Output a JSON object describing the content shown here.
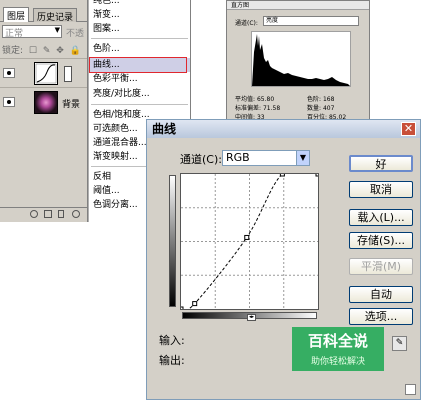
{
  "layers_panel": {
    "tabs": [
      {
        "label": "图层"
      },
      {
        "label": "历史记录"
      }
    ],
    "blend_mode": "正常",
    "opacity_label": "不透",
    "lock_label": "锁定:",
    "lock_icons": [
      "☐",
      "✎",
      "✥",
      "🔒"
    ],
    "layers": [
      {
        "name": ""
      },
      {
        "name": "背景"
      }
    ]
  },
  "image_menu": {
    "items": [
      {
        "label": "纯色..."
      },
      {
        "label": "渐变..."
      },
      {
        "label": "图案..."
      },
      {
        "label": "色阶..."
      },
      {
        "label": "曲线..."
      },
      {
        "label": "色彩平衡..."
      },
      {
        "label": "亮度/对比度..."
      },
      {
        "label": "色相/饱和度..."
      },
      {
        "label": "可选颜色..."
      },
      {
        "label": "通道混合器..."
      },
      {
        "label": "渐变映射..."
      },
      {
        "label": "反相"
      },
      {
        "label": "阈值..."
      },
      {
        "label": "色调分离..."
      }
    ],
    "selected_label": "曲线..."
  },
  "histogram_panel": {
    "title": "直方图",
    "channel_label": "通道(C):",
    "channel_value": "亮度",
    "stats": [
      {
        "label": "平均值:",
        "value": "65.80"
      },
      {
        "label": "色阶:",
        "value": "168"
      },
      {
        "label": "标准偏差:",
        "value": "71.58"
      },
      {
        "label": "数量:",
        "value": "407"
      },
      {
        "label": "中间值:",
        "value": "33"
      },
      {
        "label": "百分位:",
        "value": "85.02"
      }
    ]
  },
  "curves_dialog": {
    "title": "曲线",
    "channel_label": "通道(C):",
    "channel_value": "RGB",
    "input_label": "输入:",
    "output_label": "输出:",
    "buttons": {
      "ok": "好",
      "cancel": "取消",
      "load": "载入(L)...",
      "save": "存储(S)...",
      "smooth": "平滑(M)",
      "auto": "自动",
      "options": "选项..."
    },
    "curve_points": [
      {
        "input": 0,
        "output": 0
      },
      {
        "input": 10,
        "output": 4
      },
      {
        "input": 48,
        "output": 53
      },
      {
        "input": 74,
        "output": 100
      },
      {
        "input": 100,
        "output": 100
      }
    ]
  },
  "watermark": {
    "title": "百科全说",
    "subtitle": "助你轻松解决"
  }
}
